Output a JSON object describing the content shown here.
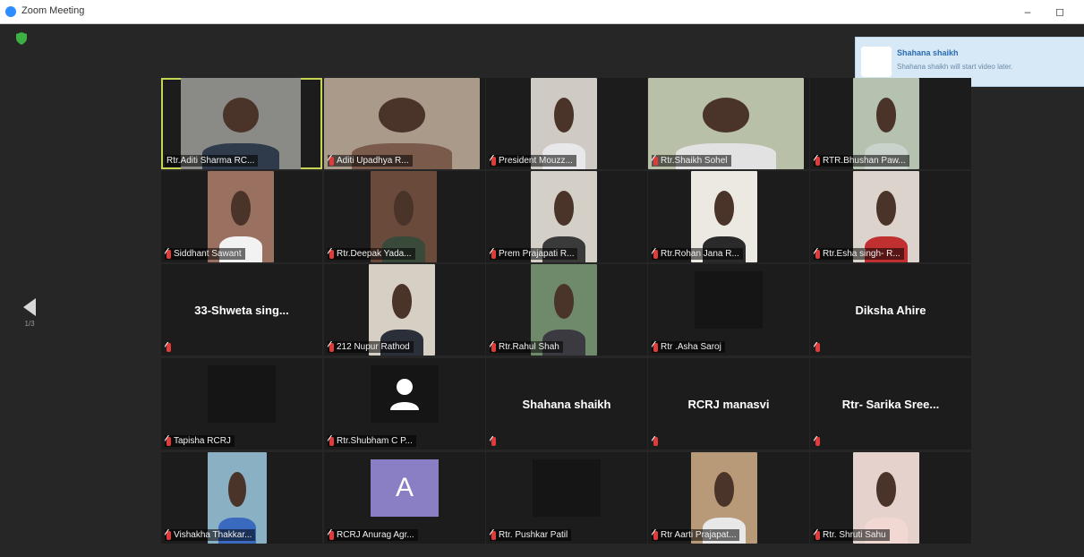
{
  "window": {
    "title": "Zoom Meeting",
    "minimize_glyph": "–",
    "restore_glyph": "◻"
  },
  "icons": [
    "shield-icon",
    "zoom-app-icon",
    "chevron-left-icon",
    "mic-muted-icon",
    "person-icon"
  ],
  "colors": {
    "accent": "#2d8cff",
    "active_border": "#c8d454",
    "muted_mic": "#e03b3b",
    "background": "#262626"
  },
  "navigation": {
    "page_indicator": "1/3"
  },
  "notification": {
    "title": "Shahana shaikh",
    "message": "Shahana shaikh will start video later."
  },
  "participants": [
    {
      "name": "Rtr.Aditi Sharma RC...",
      "muted": false,
      "active": true,
      "mode": "video"
    },
    {
      "name": "Aditi Upadhya R...",
      "muted": true,
      "mode": "video"
    },
    {
      "name": "President Mouzz...",
      "muted": true,
      "mode": "video"
    },
    {
      "name": "Rtr.Shaikh Sohel",
      "muted": true,
      "mode": "video"
    },
    {
      "name": "RTR.Bhushan Paw...",
      "muted": true,
      "mode": "video"
    },
    {
      "name": "Siddhant Sawant",
      "muted": true,
      "mode": "video"
    },
    {
      "name": "Rtr.Deepak Yada...",
      "muted": true,
      "mode": "video"
    },
    {
      "name": "Prem Prajapati R...",
      "muted": true,
      "mode": "video"
    },
    {
      "name": "Rtr.Rohan Jana R...",
      "muted": true,
      "mode": "video"
    },
    {
      "name": "Rtr.Esha singh- R...",
      "muted": true,
      "mode": "video"
    },
    {
      "display": "33-Shweta sing...",
      "muted": true,
      "mode": "name"
    },
    {
      "name": "212 Nupur Rathod",
      "muted": true,
      "mode": "video"
    },
    {
      "name": "Rtr.Rahul Shah",
      "muted": true,
      "mode": "video"
    },
    {
      "name": "Rtr .Asha Saroj",
      "muted": true,
      "mode": "dark"
    },
    {
      "display": "Diksha Ahire",
      "muted": true,
      "mode": "name"
    },
    {
      "name": "Tapisha RCRJ",
      "muted": true,
      "mode": "dark"
    },
    {
      "name": "Rtr.Shubham C P...",
      "muted": true,
      "mode": "avatar"
    },
    {
      "display": "Shahana shaikh",
      "muted": true,
      "mode": "name"
    },
    {
      "display": "RCRJ manasvi",
      "muted": true,
      "mode": "name"
    },
    {
      "display": "Rtr- Sarika Sree...",
      "muted": true,
      "mode": "name"
    },
    {
      "name": "Vishakha Thakkar...",
      "muted": true,
      "mode": "video"
    },
    {
      "name": "RCRJ Anurag Agr...",
      "muted": true,
      "mode": "letter",
      "letter": "A"
    },
    {
      "name": "Rtr. Pushkar Patil",
      "muted": true,
      "mode": "dark"
    },
    {
      "name": "Rtr Aarti Prajapat...",
      "muted": true,
      "mode": "video"
    },
    {
      "name": "Rtr. Shruti Sahu",
      "muted": true,
      "mode": "video"
    }
  ]
}
